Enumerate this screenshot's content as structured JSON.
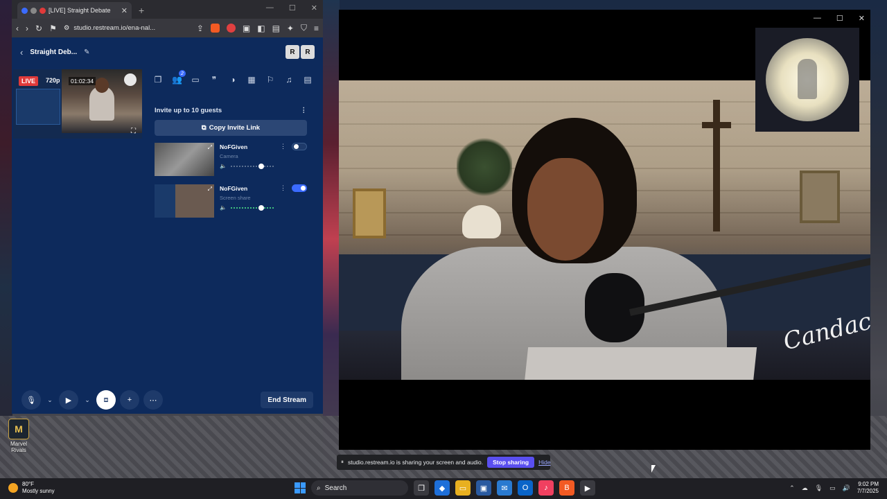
{
  "browser": {
    "tab_title": "[LIVE] Straight Debate",
    "url": "studio.restream.io/ena-nal..."
  },
  "studio": {
    "stream_name": "Straight Deb...",
    "avatars": [
      "R",
      "R"
    ],
    "live_label": "LIVE",
    "resolution": "720p",
    "timer": "01:02:34",
    "toolbar_count": "2",
    "guests_header": "Invite up to 10 guests",
    "copy_invite": "Copy Invite Link",
    "guests": [
      {
        "name": "NoFGiven",
        "source": "Camera",
        "enabled": false
      },
      {
        "name": "NoFGiven",
        "source": "Screen share",
        "enabled": true
      }
    ],
    "end_stream": "End Stream"
  },
  "video": {
    "signature": "Candace"
  },
  "share_bar": {
    "message": "studio.restream.io is sharing your screen and audio.",
    "stop": "Stop sharing",
    "hide": "Hide"
  },
  "desktop": {
    "icon_label": "Marvel Rivals"
  },
  "taskbar": {
    "temperature": "80°F",
    "condition": "Mostly sunny",
    "search_label": "Search",
    "time": "9:02 PM",
    "date": "7/7/2025"
  },
  "colors": {
    "studio_bg": "#0d2a5c",
    "live_red": "#e03a3a",
    "accent_blue": "#3b6bff",
    "stop_sharing": "#5a4ff0"
  }
}
